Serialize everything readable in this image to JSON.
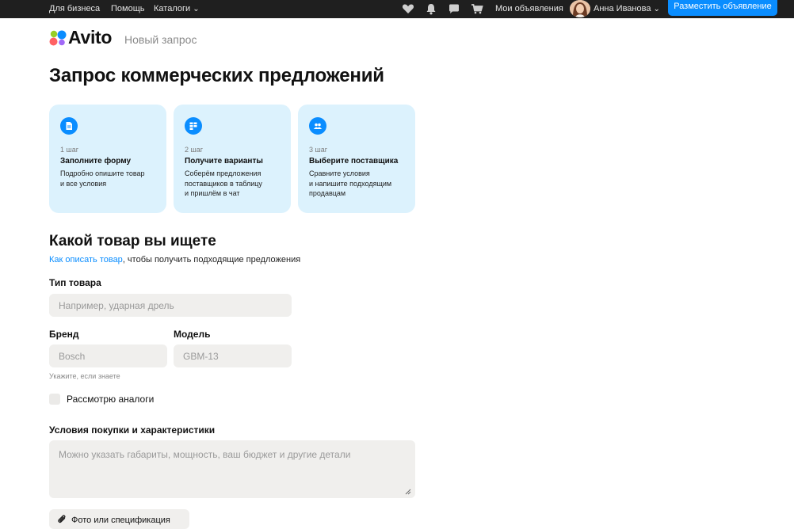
{
  "topbar": {
    "business": "Для бизнеса",
    "help": "Помощь",
    "catalogs": "Каталоги",
    "catalogs_chevron": "⌄",
    "icons": [
      "heart-icon",
      "bell-icon",
      "chat-icon",
      "cart-icon"
    ],
    "my_ads": "Мои объявления",
    "user_name": "Анна Иванова",
    "user_chevron": "⌄",
    "post_ad": "Разместить объявление"
  },
  "header": {
    "logo": "Avito",
    "subtitle": "Новый запрос",
    "logo_colors": [
      "#97cf26",
      "#0a8dff",
      "#ff6163",
      "#a169f7"
    ]
  },
  "page": {
    "title": "Запрос коммерческих предложений"
  },
  "steps": [
    {
      "icon": "document-icon",
      "num": "1 шаг",
      "title": "Заполните форму",
      "desc_lines": [
        "Подробно опишите товар",
        "и все условия"
      ]
    },
    {
      "icon": "table-icon",
      "num": "2 шаг",
      "title": "Получите варианты",
      "desc_lines": [
        "Соберём предложения",
        "поставщиков в таблицу",
        "и пришлём в чат"
      ]
    },
    {
      "icon": "people-icon",
      "num": "3 шаг",
      "title": "Выберите поставщика",
      "desc_lines": [
        "Сравните условия",
        "и напишите подходящим",
        "продавцам"
      ]
    }
  ],
  "form": {
    "section_title": "Какой товар вы ищете",
    "hint_link": "Как описать товар",
    "hint_rest": ", чтобы получить подходящие предложения",
    "type_label": "Тип товара",
    "type_placeholder": "Например, ударная дрель",
    "brand_label": "Бренд",
    "brand_placeholder": "Bosch",
    "model_label": "Модель",
    "model_placeholder": "GBM-13",
    "brand_hint": "Укажите, если знаете",
    "analogs_label": "Рассмотрю аналоги",
    "conditions_label": "Условия покупки и характеристики",
    "conditions_placeholder": "Можно указать габариты, мощность, ваш бюджет и другие детали",
    "attach_label": "Фото или спецификация"
  },
  "colors": {
    "accent": "#0a8dff",
    "card_bg": "#dcf2fd",
    "field_bg": "#f0efed",
    "topbar_bg": "#1f1f1f"
  }
}
